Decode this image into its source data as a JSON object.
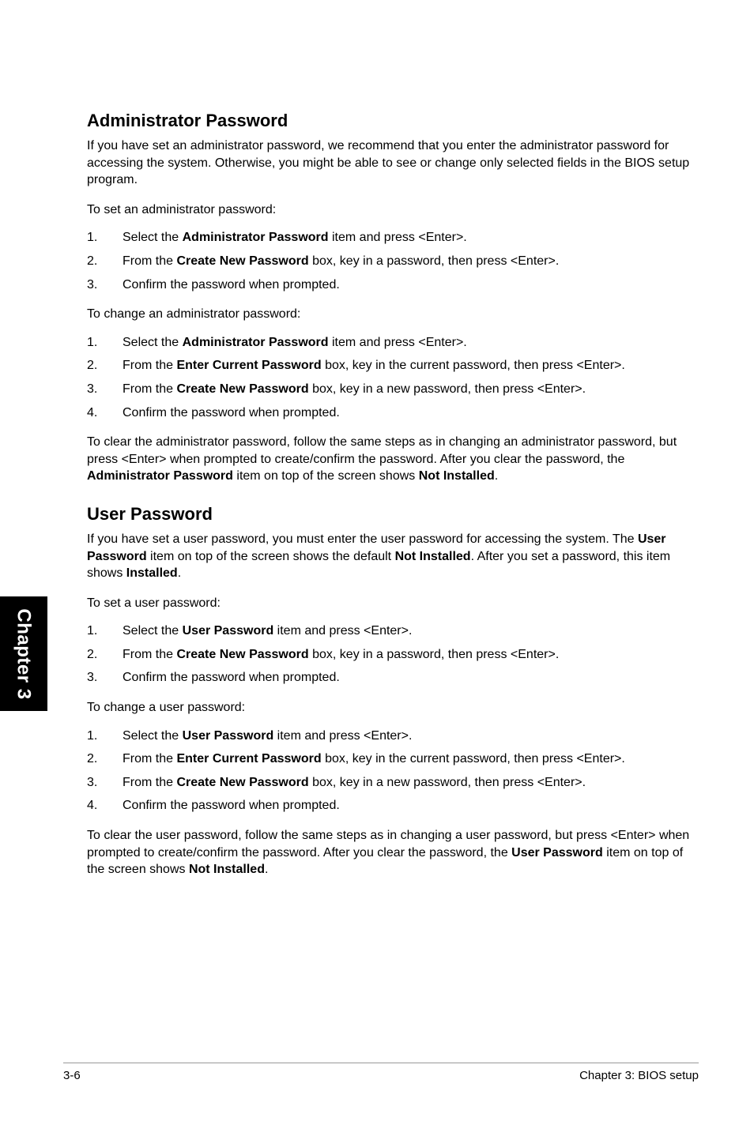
{
  "sidebar": {
    "label": "Chapter 3"
  },
  "sections": {
    "admin": {
      "title": "Administrator Password",
      "intro": "If you have set an administrator password, we recommend that you enter the administrator password for accessing the system. Otherwise, you might be able to see or change only selected fields in the BIOS setup program.",
      "set_lead": "To set an administrator password:",
      "set1_a": "Select the ",
      "set1_b": "Administrator Password",
      "set1_c": " item and press <Enter>.",
      "set2_a": "From the ",
      "set2_b": "Create New Password",
      "set2_c": " box, key in a password, then press <Enter>.",
      "set3": "Confirm the password when prompted.",
      "change_lead": "To change an administrator password:",
      "chg1_a": "Select the ",
      "chg1_b": "Administrator Password",
      "chg1_c": " item and press <Enter>.",
      "chg2_a": "From the ",
      "chg2_b": "Enter Current Password",
      "chg2_c": " box, key in the current password, then press <Enter>.",
      "chg3_a": "From the ",
      "chg3_b": "Create New Password",
      "chg3_c": " box, key in a new password, then press <Enter>.",
      "chg4": "Confirm the password when prompted.",
      "clear_a": "To clear the administrator password, follow the same steps as in changing an administrator password, but press <Enter> when prompted to create/confirm the password. After you clear the password, the ",
      "clear_b": "Administrator Password",
      "clear_c": " item on top of the screen shows ",
      "clear_d": "Not Installed",
      "clear_e": "."
    },
    "user": {
      "title": "User Password",
      "intro_a": "If you have set a user password, you must enter the user password for accessing the system. The ",
      "intro_b": "User Password",
      "intro_c": " item on top of the screen shows the default ",
      "intro_d": "Not Installed",
      "intro_e": ". After you set a password, this item shows ",
      "intro_f": "Installed",
      "intro_g": ".",
      "set_lead": "To set a user password:",
      "set1_a": "Select the ",
      "set1_b": "User Password",
      "set1_c": " item and press <Enter>.",
      "set2_a": "From the ",
      "set2_b": "Create New Password",
      "set2_c": " box, key in a password, then press <Enter>.",
      "set3": "Confirm the password when prompted.",
      "change_lead": "To change a user password:",
      "chg1_a": "Select the ",
      "chg1_b": "User Password",
      "chg1_c": " item and press <Enter>.",
      "chg2_a": "From the ",
      "chg2_b": "Enter Current Password",
      "chg2_c": " box, key in the current password, then press <Enter>.",
      "chg3_a": "From the ",
      "chg3_b": "Create New Password",
      "chg3_c": " box, key in a new password, then press <Enter>.",
      "chg4": "Confirm the password when prompted.",
      "clear_a": "To clear the user password, follow the same steps as in changing a user password, but press <Enter> when prompted to create/confirm the password. After you clear the password, the ",
      "clear_b": "User Password",
      "clear_c": " item on top of the screen shows ",
      "clear_d": "Not Installed",
      "clear_e": "."
    }
  },
  "footer": {
    "left": "3-6",
    "right": "Chapter 3: BIOS setup"
  }
}
